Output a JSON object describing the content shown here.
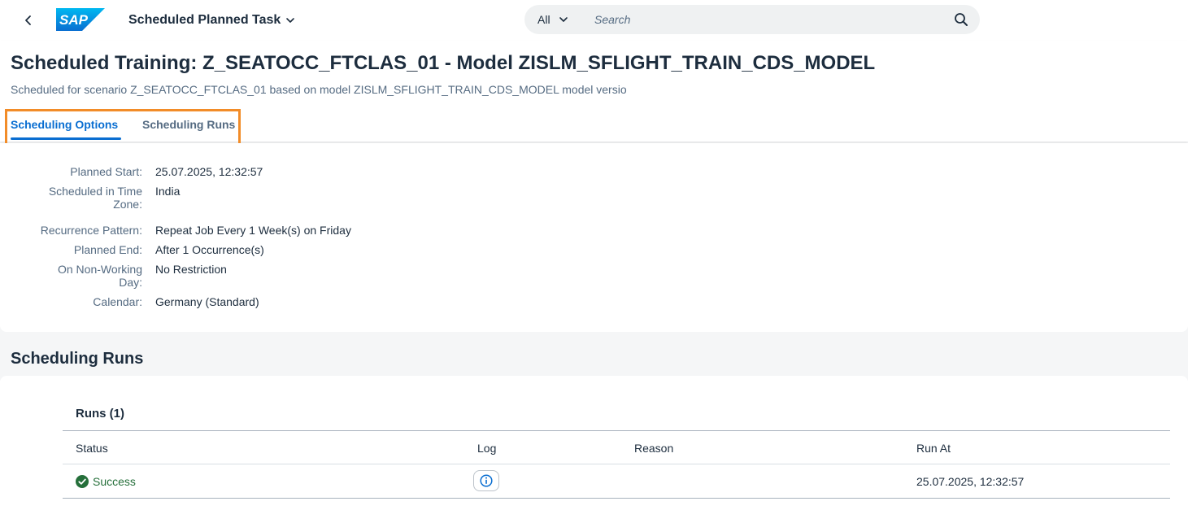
{
  "shell": {
    "logo_text": "SAP",
    "app_title": "Scheduled Planned Task",
    "search_scope": "All",
    "search_placeholder": "Search"
  },
  "header": {
    "title": "Scheduled Training: Z_SEATOCC_FTCLAS_01 - Model ZISLM_SFLIGHT_TRAIN_CDS_MODEL",
    "subtitle": "Scheduled for scenario Z_SEATOCC_FTCLAS_01 based on model ZISLM_SFLIGHT_TRAIN_CDS_MODEL model versio",
    "tabs": [
      {
        "label": "Scheduling Options",
        "active": true
      },
      {
        "label": "Scheduling Runs",
        "active": false
      }
    ]
  },
  "options": {
    "planned_start": {
      "label": "Planned Start:",
      "value": "25.07.2025, 12:32:57"
    },
    "time_zone": {
      "label_line1": "Scheduled in Time",
      "label_line2": "Zone:",
      "value": "India"
    },
    "recurrence": {
      "label": "Recurrence Pattern:",
      "value": "Repeat Job Every 1 Week(s) on Friday"
    },
    "planned_end": {
      "label": "Planned End:",
      "value": "After 1 Occurrence(s)"
    },
    "non_working": {
      "label_line1": "On Non-Working",
      "label_line2": "Day:",
      "value": "No Restriction"
    },
    "calendar": {
      "label": "Calendar:",
      "value": "Germany (Standard)"
    }
  },
  "runs": {
    "heading": "Scheduling Runs",
    "table_title": "Runs (1)",
    "columns": {
      "status": "Status",
      "log": "Log",
      "reason": "Reason",
      "run_at": "Run At"
    },
    "rows": [
      {
        "status": "Success",
        "reason": "",
        "run_at": "25.07.2025, 12:32:57"
      }
    ]
  },
  "colors": {
    "accent": "#0a6ed1",
    "success": "#256f3a",
    "highlight": "#f28c28",
    "logo": "#0a6ed1"
  },
  "icons": [
    "back-arrow-icon",
    "chevron-down-icon",
    "search-icon",
    "success-check-icon",
    "info-icon"
  ]
}
